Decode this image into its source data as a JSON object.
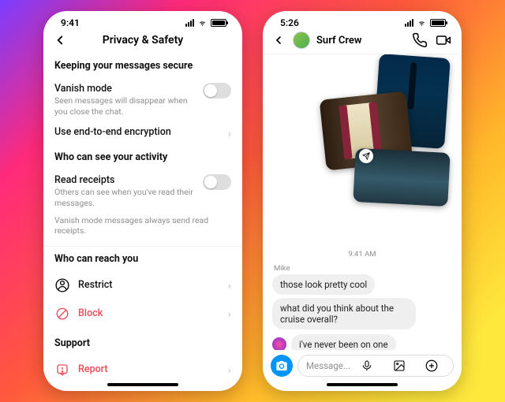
{
  "left": {
    "status": {
      "time": "9:41"
    },
    "header": {
      "title": "Privacy & Safety"
    },
    "sections": {
      "secure": {
        "heading": "Keeping your messages secure",
        "vanish": {
          "label": "Vanish mode",
          "sub": "Seen messages will disappear when you close the chat."
        },
        "e2e": {
          "label": "Use end-to-end encryption"
        }
      },
      "activity": {
        "heading": "Who can see your activity",
        "receipts": {
          "label": "Read receipts",
          "sub": "Others can see when you've read their messages."
        },
        "note": "Vanish mode messages always send read receipts."
      },
      "reach": {
        "heading": "Who can reach you",
        "restrict": "Restrict",
        "block": "Block"
      },
      "support": {
        "heading": "Support",
        "report": "Report"
      }
    }
  },
  "right": {
    "status": {
      "time": "5:26"
    },
    "header": {
      "name": "Surf Crew"
    },
    "timestamp": "9:41 AM",
    "sender": "Mike",
    "messages": {
      "m1": "those look pretty cool",
      "m2": "what did you think about the cruise overall?",
      "m3": "i've never been on one"
    },
    "composer": {
      "placeholder": "Message..."
    }
  }
}
